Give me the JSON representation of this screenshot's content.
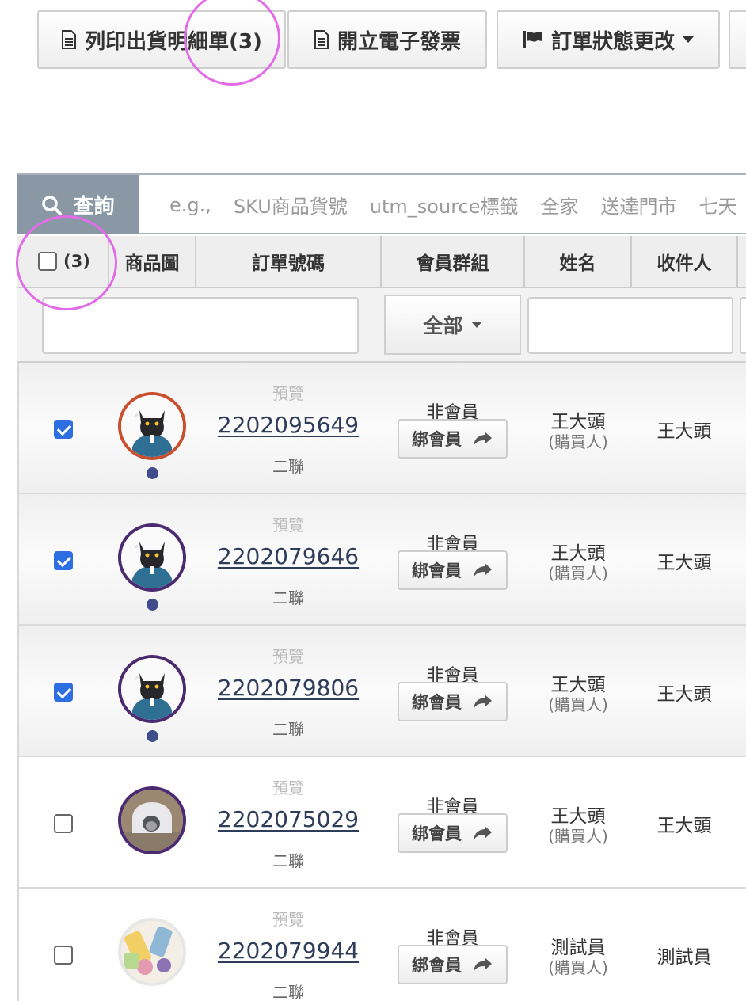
{
  "toolbar": {
    "print_label": "列印出貨明細單(3)",
    "invoice_label": "開立電子發票",
    "status_label": "訂單狀態更改",
    "icons": [
      "document-icon",
      "document-icon",
      "flag-icon",
      "caret-down-icon"
    ]
  },
  "search": {
    "button_label": "查詢",
    "hints": [
      "e.g.,",
      "SKU商品貨號",
      "utm_source標籤",
      "全家",
      "送達門市",
      "七天"
    ]
  },
  "table": {
    "select_count": "(3)",
    "headers": {
      "image": "商品圖",
      "order_no": "訂單號碼",
      "member_group": "會員群組",
      "name": "姓名",
      "recipient": "收件人"
    },
    "filter": {
      "member_group_selected": "全部"
    },
    "rows": [
      {
        "checked": true,
        "avatar": "cat-avatar",
        "ring": "#c8502f",
        "has_dot": true,
        "preview": "預覽",
        "order_no": "2202095649",
        "copy": "二聯",
        "member_status": "非會員",
        "bind_label": "綁會員",
        "name": "王大頭",
        "buyer_tag": "(購買人)",
        "recipient": "王大頭"
      },
      {
        "checked": true,
        "avatar": "cat-avatar",
        "ring": "#4b2a6f",
        "has_dot": true,
        "preview": "預覽",
        "order_no": "2202079646",
        "copy": "二聯",
        "member_status": "非會員",
        "bind_label": "綁會員",
        "name": "王大頭",
        "buyer_tag": "(購買人)",
        "recipient": "王大頭"
      },
      {
        "checked": true,
        "avatar": "cat-avatar",
        "ring": "#4b2a6f",
        "has_dot": true,
        "preview": "預覽",
        "order_no": "2202079806",
        "copy": "二聯",
        "member_status": "非會員",
        "bind_label": "綁會員",
        "name": "王大頭",
        "buyer_tag": "(購買人)",
        "recipient": "王大頭"
      },
      {
        "checked": false,
        "avatar": "litter-box-avatar",
        "ring": "#4b2a6f",
        "has_dot": false,
        "preview": "預覽",
        "order_no": "2202075029",
        "copy": "二聯",
        "member_status": "非會員",
        "bind_label": "綁會員",
        "name": "王大頭",
        "buyer_tag": "(購買人)",
        "recipient": "王大頭"
      },
      {
        "checked": false,
        "avatar": "food-avatar",
        "ring": "#e6e6e6",
        "has_dot": false,
        "preview": "預覽",
        "order_no": "2202079944",
        "copy": "二聯",
        "member_status": "非會員",
        "bind_label": "綁會員",
        "name": "測試員",
        "buyer_tag": "(購買人)",
        "recipient": "測試員"
      }
    ]
  },
  "colors": {
    "accent": "#2d6fe3",
    "annotation": "#e26ce8",
    "search_button": "#8a98a6"
  }
}
